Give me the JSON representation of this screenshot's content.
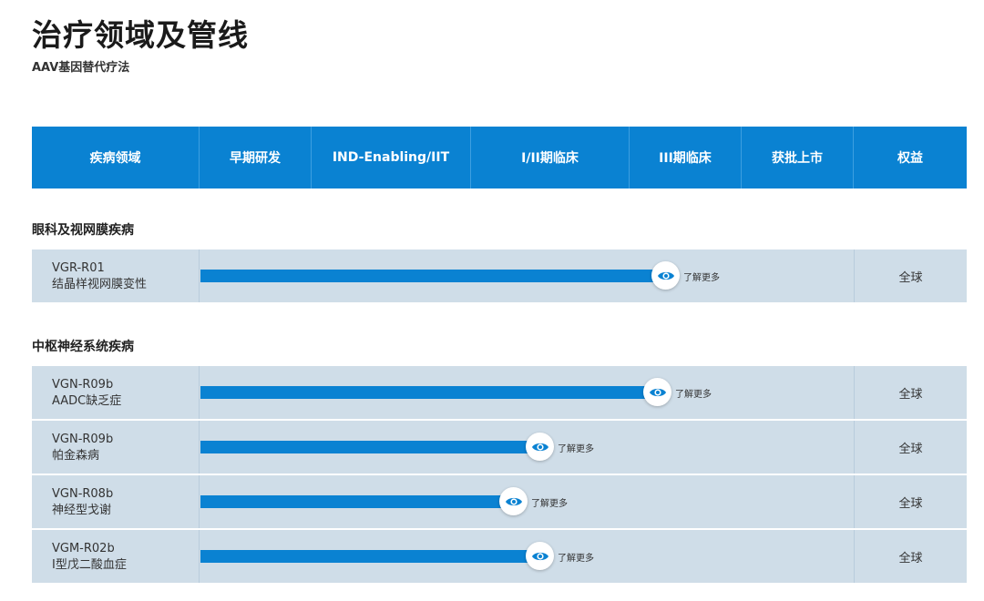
{
  "page": {
    "title": "治疗领域及管线",
    "subtitle": "AAV基因替代疗法"
  },
  "header": {
    "columns": [
      "疾病领域",
      "早期研发",
      "IND-Enabling/IIT",
      "I/II期临床",
      "III期临床",
      "获批上市",
      "权益"
    ]
  },
  "colors": {
    "accent": "#0a82d2",
    "row_bg": "#cfdde8"
  },
  "icons": {
    "learn_more": "eye-icon"
  },
  "sections": [
    {
      "title": "眼科及视网膜疾病",
      "rows": [
        {
          "code": "VGR-R01",
          "disease": "结晶样视网膜变性",
          "progress": 0.712,
          "learn_more": "了解更多",
          "rights": "全球"
        }
      ]
    },
    {
      "title": "中枢神经系统疾病",
      "rows": [
        {
          "code": "VGN-R09b",
          "disease": "AADC缺乏症",
          "progress": 0.7,
          "learn_more": "了解更多",
          "rights": "全球"
        },
        {
          "code": "VGN-R09b",
          "disease": "帕金森病",
          "progress": 0.52,
          "learn_more": "了解更多",
          "rights": "全球"
        },
        {
          "code": "VGN-R08b",
          "disease": "神经型戈谢",
          "progress": 0.48,
          "learn_more": "了解更多",
          "rights": "全球"
        },
        {
          "code": "VGM-R02b",
          "disease": "I型戊二酸血症",
          "progress": 0.52,
          "learn_more": "了解更多",
          "rights": "全球"
        }
      ]
    }
  ]
}
